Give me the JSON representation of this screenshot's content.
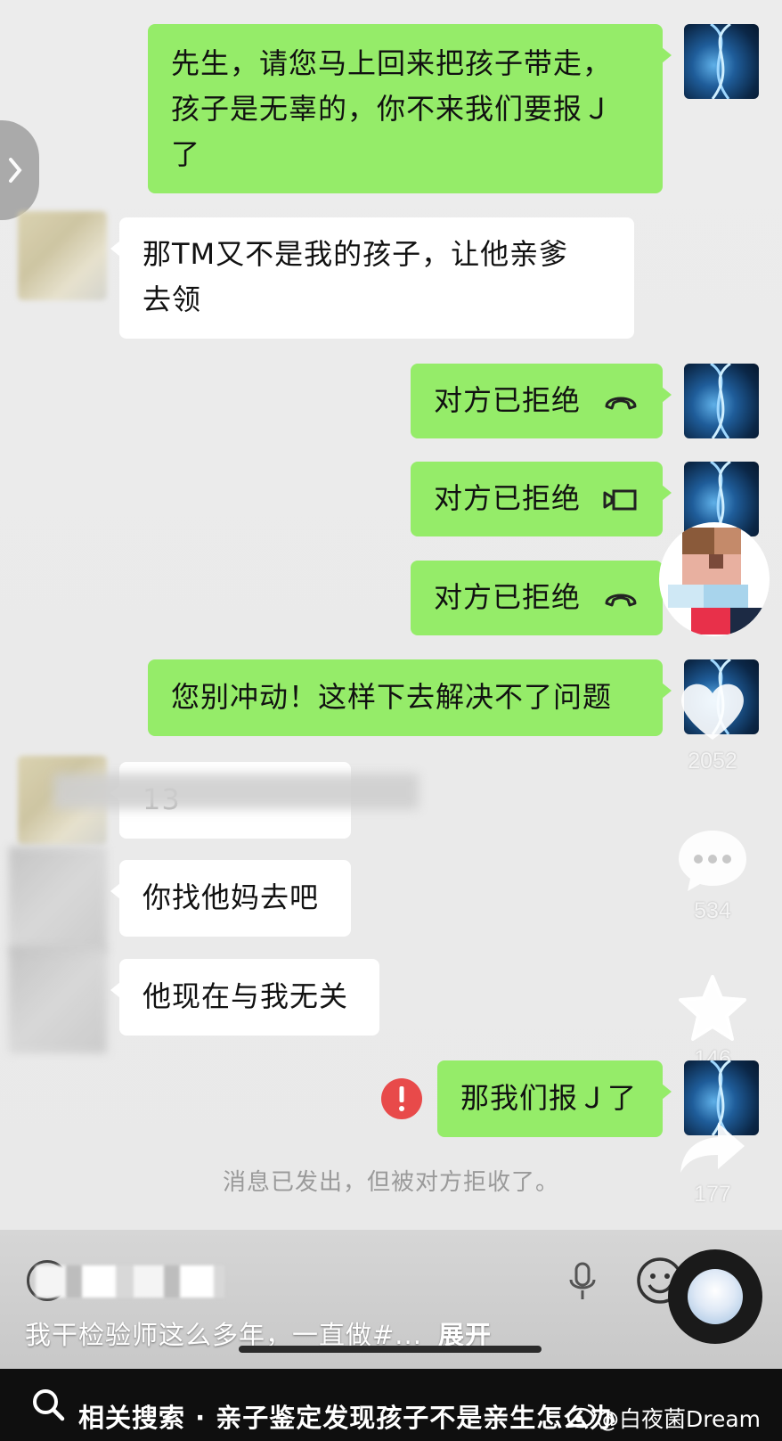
{
  "messages": {
    "m1": "先生，请您马上回来把孩子带走，孩子是无辜的，你不来我们要报Ｊ了",
    "m1_lines": [
      "先生，请您马上回来把孩子带走，",
      "孩子是无辜的，你不来我们要报Ｊ",
      "了"
    ],
    "m2_lines": [
      "那TM又不是我的孩子，让他亲爹",
      "去领"
    ],
    "m3": "对方已拒绝",
    "m4": "对方已拒绝",
    "m5": "对方已拒绝",
    "m6": "您别冲动！这样下去解决不了问题",
    "m7_partial": "13",
    "m8": "你找他妈去吧",
    "m9": "他现在与我无关",
    "m10": "那我们报Ｊ了",
    "notice": "消息已发出，但被对方拒收了。"
  },
  "side_actions": {
    "likes": "2052",
    "comments": "534",
    "favorites": "146",
    "shares": "177"
  },
  "caption": {
    "text": "我干检验师这么多年，一直做#...",
    "expand": "展开"
  },
  "search": {
    "prefix": "相关搜索 · ",
    "query": "亲子鉴定发现孩子不是亲生怎么办"
  },
  "watermark": "@白夜菌Dream",
  "colors": {
    "sent_bubble": "#95ec69",
    "received_bubble": "#ffffff",
    "error_badge": "#e84a4a",
    "background": "#ebebeb"
  },
  "icons": [
    "chevron-right-icon",
    "phone-hangup-icon",
    "video-call-icon",
    "error-icon",
    "heart-icon",
    "comment-icon",
    "star-icon",
    "share-icon",
    "mic-icon",
    "emoji-icon",
    "search-icon",
    "weibo-icon"
  ]
}
